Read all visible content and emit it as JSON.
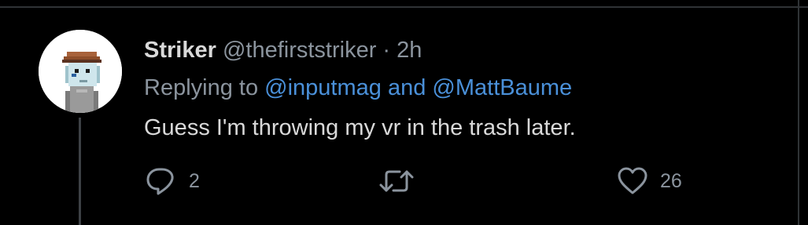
{
  "tweet": {
    "display_name": "Striker",
    "handle": "@thefirststriker",
    "separator": " · ",
    "time": "2h",
    "replying_prefix": "Replying to ",
    "mention_one": "@inputmag",
    "mention_joiner": " and ",
    "mention_two": "@MattBaume",
    "text": "Guess I'm throwing my vr in the trash later."
  },
  "actions": {
    "reply_icon": "reply-bubble-icon",
    "reply_count": "2",
    "retweet_icon": "retweet-icon",
    "like_icon": "heart-icon",
    "like_count": "26"
  },
  "colors": {
    "background": "#000000",
    "primary_text": "#d9d9d9",
    "secondary_text": "#8b949e",
    "link": "#4a90d9",
    "divider": "#2f3336"
  }
}
